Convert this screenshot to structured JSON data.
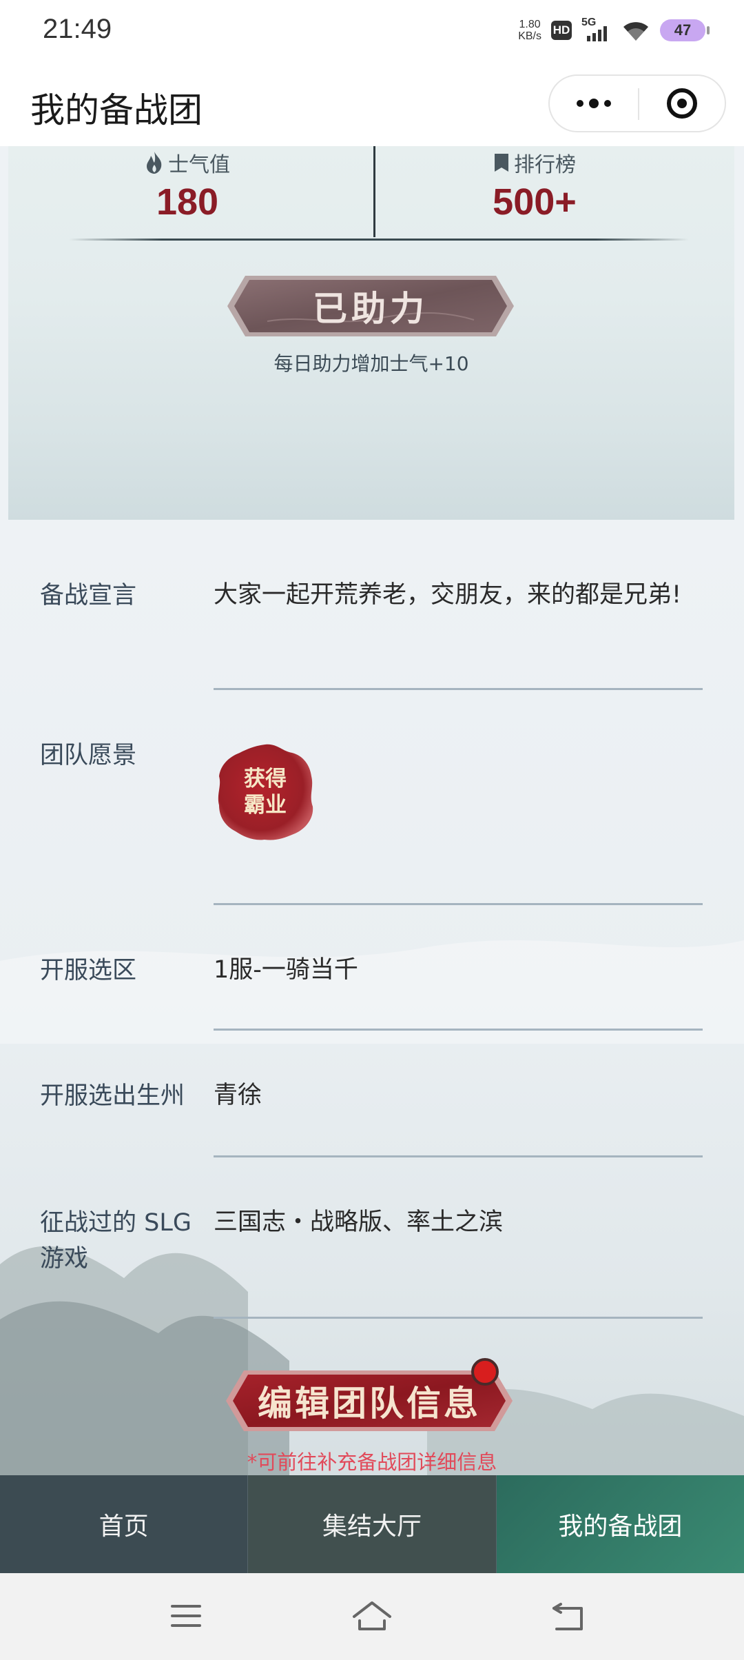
{
  "status_bar": {
    "time": "21:49",
    "net_speed_value": "1.80",
    "net_speed_unit": "KB/s",
    "hd": "HD",
    "network": "5G",
    "battery": "47",
    "battery_color": "#c8a7f1"
  },
  "title_bar": {
    "title": "我的备战团",
    "more_icon": "more-dots-icon",
    "close_icon": "target-circle-icon"
  },
  "hero": {
    "morale_label": "士气值",
    "morale_icon": "flame-icon",
    "morale_value": "180",
    "rank_label": "排行榜",
    "rank_icon": "bookmark-icon",
    "rank_value": "500+",
    "helped_button": "已助力",
    "helped_hint": "每日助力增加士气+10",
    "value_color": "#8a1c26"
  },
  "info": {
    "declaration_label": "备战宣言",
    "declaration_value": "大家一起开荒养老，交朋友，来的都是兄弟!",
    "vision_label": "团队愿景",
    "vision_seal_line1": "获得",
    "vision_seal_line2": "霸业",
    "server_label": "开服选区",
    "server_value": "1服-一骑当千",
    "state_label": "开服选出生州",
    "state_value": "青徐",
    "slg_label": "征战过的 SLG 游戏",
    "slg_value": "三国志・战略版、率土之滨",
    "edit_button": "编辑团队信息",
    "edit_hint": "*可前往补充备战团详细信息",
    "hint_color": "#e14a5a"
  },
  "tab_bar": {
    "tabs": [
      {
        "label": "首页"
      },
      {
        "label": "集结大厅"
      },
      {
        "label": "我的备战团"
      }
    ],
    "active_color": "#2c6b5d"
  },
  "nav_bar": {
    "menu_icon": "menu-icon",
    "home_icon": "home-icon",
    "back_icon": "back-icon"
  }
}
